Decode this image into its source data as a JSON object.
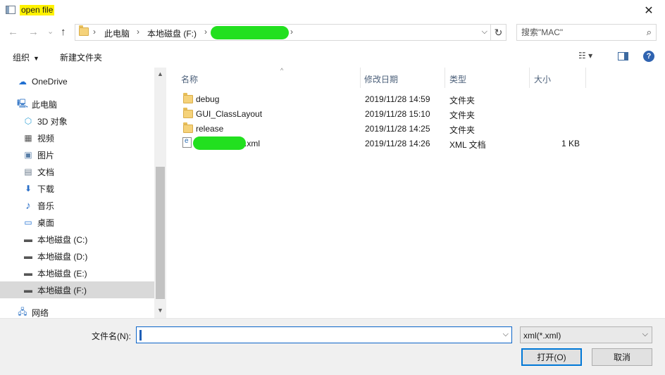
{
  "window": {
    "title": "open file",
    "close_glyph": "✕"
  },
  "nav": {
    "back_glyph": "←",
    "forward_glyph": "→",
    "recent_glyph": "⌄",
    "up_glyph": "↑",
    "breadcrumbs": [
      "此电脑",
      "本地磁盘 (F:)"
    ],
    "separator": "›",
    "address_dropdown_glyph": "⌵",
    "refresh_glyph": "↻"
  },
  "search": {
    "placeholder": "搜索\"MAC\"",
    "icon": "search-icon",
    "icon_glyph": "⌕"
  },
  "toolbar": {
    "organize_label": "组织",
    "organize_caret": "▼",
    "new_folder_label": "新建文件夹",
    "view_menu_glyph": "☷ ▾",
    "help_glyph": "?"
  },
  "sidebar": {
    "items": [
      {
        "label": "OneDrive",
        "icon": "cloud-icon",
        "glyph": "☁"
      },
      {
        "label": "此电脑",
        "icon": "computer-icon",
        "glyph": "🖳"
      },
      {
        "label": "3D 对象",
        "icon": "cube-icon",
        "glyph": "⬡"
      },
      {
        "label": "视频",
        "icon": "video-icon",
        "glyph": "▦"
      },
      {
        "label": "图片",
        "icon": "picture-icon",
        "glyph": "▣"
      },
      {
        "label": "文档",
        "icon": "document-icon",
        "glyph": "▤"
      },
      {
        "label": "下载",
        "icon": "download-icon",
        "glyph": "⬇"
      },
      {
        "label": "音乐",
        "icon": "music-icon",
        "glyph": "♪"
      },
      {
        "label": "桌面",
        "icon": "desktop-icon",
        "glyph": "▭"
      },
      {
        "label": "本地磁盘 (C:)",
        "icon": "drive-icon",
        "glyph": "▬"
      },
      {
        "label": "本地磁盘 (D:)",
        "icon": "drive-icon",
        "glyph": "▬"
      },
      {
        "label": "本地磁盘 (E:)",
        "icon": "drive-icon",
        "glyph": "▬"
      },
      {
        "label": "本地磁盘 (F:)",
        "icon": "drive-icon",
        "glyph": "▬"
      },
      {
        "label": "网络",
        "icon": "network-icon",
        "glyph": "🖧"
      }
    ],
    "selected_index": 12,
    "scroll_up_glyph": "▲",
    "scroll_down_glyph": "▼"
  },
  "files": {
    "columns": [
      "名称",
      "修改日期",
      "类型",
      "大小"
    ],
    "sort_glyph": "^",
    "rows": [
      {
        "name": "debug",
        "modified": "2019/11/28 14:59",
        "type": "文件夹",
        "size": "",
        "icon": "folder-icon"
      },
      {
        "name": "GUI_ClassLayout",
        "modified": "2019/11/28 15:10",
        "type": "文件夹",
        "size": "",
        "icon": "folder-icon"
      },
      {
        "name": "release",
        "modified": "2019/11/28 14:25",
        "type": "文件夹",
        "size": "",
        "icon": "folder-icon"
      },
      {
        "name": ".xml",
        "modified": "2019/11/28 14:26",
        "type": "XML 文档",
        "size": "1 KB",
        "icon": "xml-file-icon"
      }
    ]
  },
  "footer": {
    "filename_label": "文件名(N):",
    "filename_value": "",
    "filetype_selected": "xml(*.xml)",
    "dropdown_glyph": "⌵",
    "open_button": "打开(O)",
    "cancel_button": "取消"
  },
  "colors": {
    "highlight_title": "#fff200",
    "redaction": "#22e01f",
    "selection": "#d9d9d9",
    "accent": "#0078d7"
  }
}
